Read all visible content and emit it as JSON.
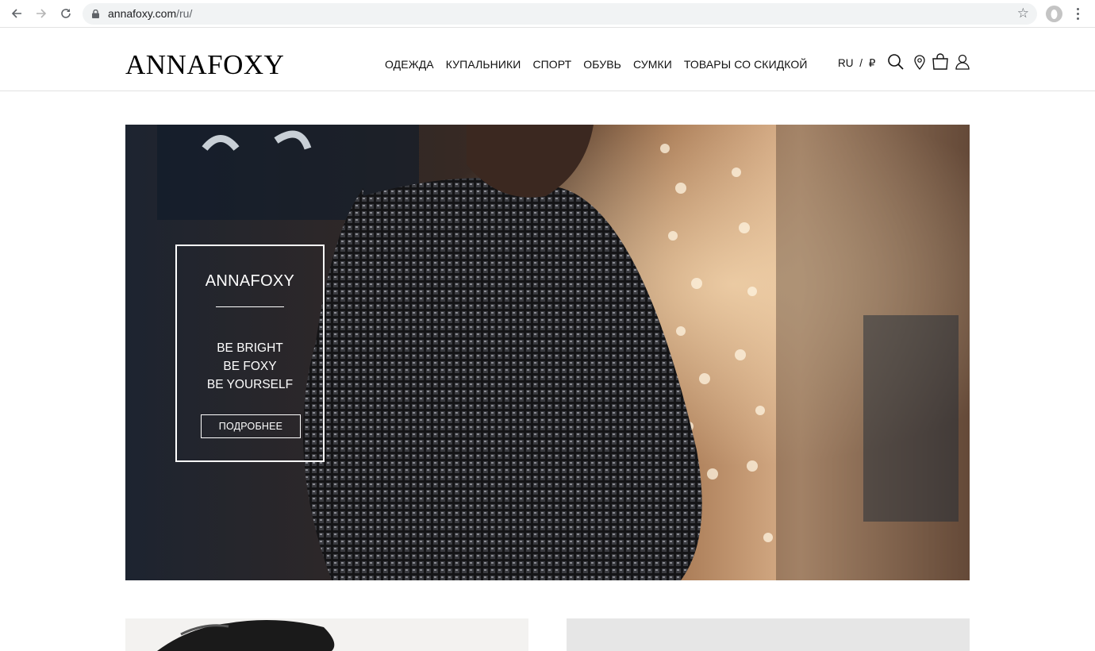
{
  "browser": {
    "url_host": "annafoxy.com",
    "url_path": "/ru/",
    "icons": [
      "back-arrow-icon",
      "forward-arrow-icon",
      "reload-icon",
      "lock-icon",
      "star-icon",
      "profile-avatar",
      "kebab-menu-icon"
    ]
  },
  "header": {
    "logo": "ANNAFOXY",
    "menu": [
      {
        "label": "ОДЕЖДА"
      },
      {
        "label": "КУПАЛЬНИКИ"
      },
      {
        "label": "СПОРТ"
      },
      {
        "label": "ОБУВЬ"
      },
      {
        "label": "СУМКИ"
      },
      {
        "label": "ТОВАРЫ СО СКИДКОЙ"
      }
    ],
    "lang": "RU",
    "lang_sep": "/",
    "currency": "₽",
    "icons": [
      "search-icon",
      "location-pin-icon",
      "shopping-bag-icon",
      "user-icon"
    ]
  },
  "hero": {
    "brand": "ANNAFOXY",
    "lines": [
      "BE BRIGHT",
      "BE FOXY",
      "BE YOURSELF"
    ],
    "button": "ПОДРОБНЕЕ"
  },
  "colors": {
    "text": "#111111",
    "hero_dark": "#2a221d",
    "hero_warm": "#c99a6a",
    "white": "#ffffff"
  }
}
